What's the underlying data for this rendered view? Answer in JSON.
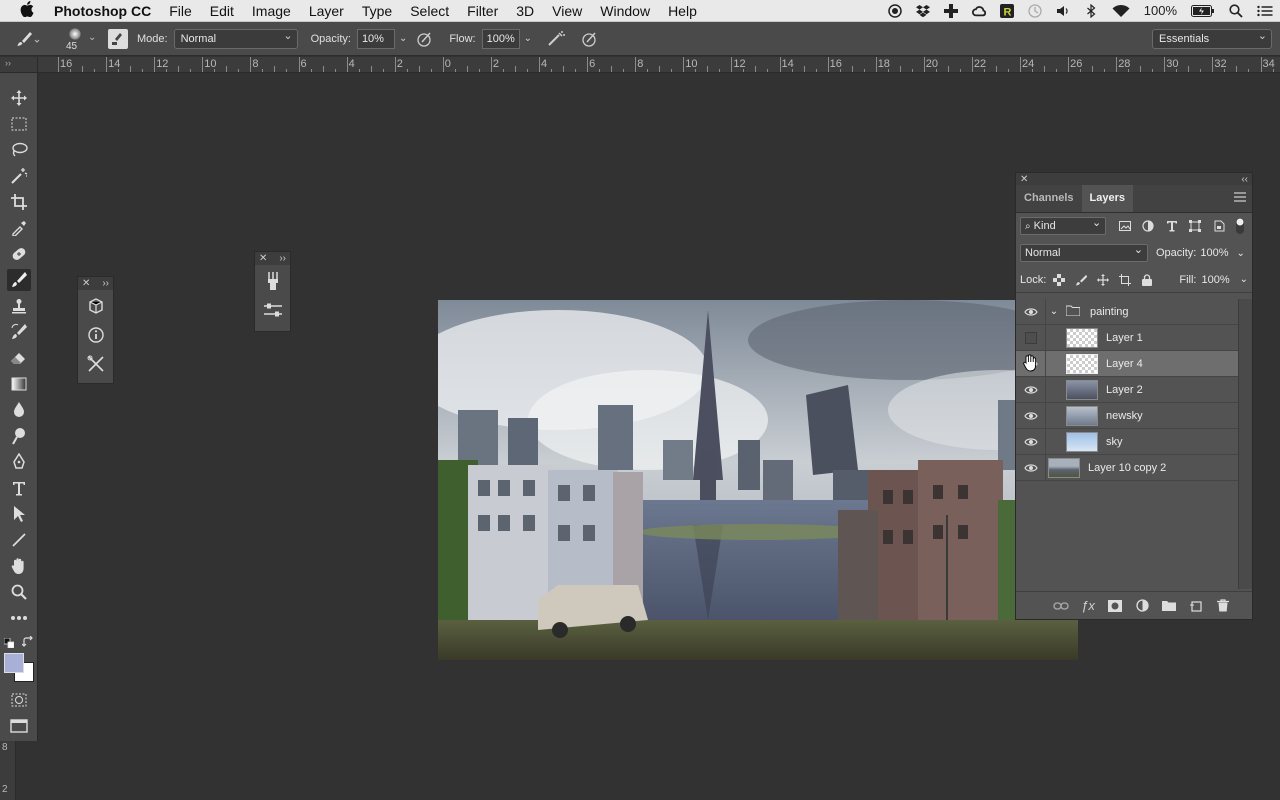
{
  "menubar": {
    "app_name": "Photoshop CC",
    "items": [
      "File",
      "Edit",
      "Image",
      "Layer",
      "Type",
      "Select",
      "Filter",
      "3D",
      "View",
      "Window",
      "Help"
    ],
    "battery": "100%"
  },
  "options_bar": {
    "brush_size": "45",
    "mode_label": "Mode:",
    "mode_value": "Normal",
    "opacity_label": "Opacity:",
    "opacity_value": "10%",
    "flow_label": "Flow:",
    "flow_value": "100%",
    "workspace": "Essentials"
  },
  "ruler": {
    "top_labels": [
      "16",
      "14",
      "12",
      "10",
      "8",
      "6",
      "4",
      "2",
      "0",
      "2",
      "4",
      "6",
      "8",
      "10",
      "12",
      "14",
      "16",
      "18",
      "20",
      "22",
      "24",
      "26",
      "28",
      "30",
      "32",
      "34"
    ],
    "left_labels": [
      "8",
      "2"
    ]
  },
  "layers_panel": {
    "tabs": [
      {
        "label": "Channels",
        "active": false
      },
      {
        "label": "Layers",
        "active": true
      }
    ],
    "filter_kind": "Kind",
    "blend_mode": "Normal",
    "opacity_label": "Opacity:",
    "opacity_value": "100%",
    "lock_label": "Lock:",
    "fill_label": "Fill:",
    "fill_value": "100%",
    "layers": [
      {
        "name": "painting",
        "type": "group",
        "visible": true,
        "selected": false
      },
      {
        "name": "Layer 1",
        "type": "layer",
        "visible": false,
        "selected": false
      },
      {
        "name": "Layer 4",
        "type": "layer",
        "visible": true,
        "selected": true
      },
      {
        "name": "Layer 2",
        "type": "layer",
        "visible": true,
        "selected": false
      },
      {
        "name": "newsky",
        "type": "layer",
        "visible": true,
        "selected": false
      },
      {
        "name": "sky",
        "type": "layer",
        "visible": true,
        "selected": false
      },
      {
        "name": "Layer 10 copy 2",
        "type": "layer",
        "visible": true,
        "selected": false
      }
    ]
  },
  "colors": {
    "foreground": "#a8b0d8",
    "background": "#ffffff"
  }
}
